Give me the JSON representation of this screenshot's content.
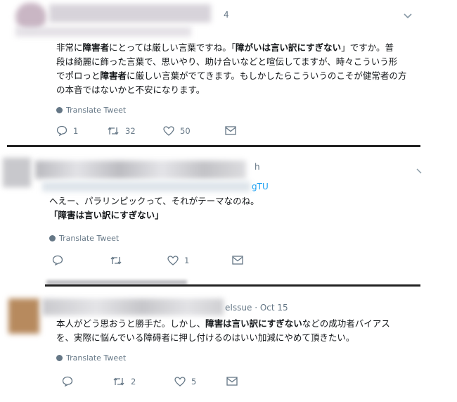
{
  "tweets": [
    {
      "header_suffix": "4",
      "text_lines": [
        [
          {
            "t": "非常に",
            "b": false
          },
          {
            "t": "障害者",
            "b": true
          },
          {
            "t": "にとっては厳しい言葉ですね。「",
            "b": false
          },
          {
            "t": "障がいは言い訳にすぎない",
            "b": true
          },
          {
            "t": "」ですか。普",
            "b": false
          }
        ],
        [
          {
            "t": "段は綺麗に飾った言葉で、思いやり、助け合いなどと喧伝してますが、時々こういう形",
            "b": false
          }
        ],
        [
          {
            "t": "でポロっと",
            "b": false
          },
          {
            "t": "障害者",
            "b": true
          },
          {
            "t": "に厳しい言葉がでてきます。もしかしたらこういうのこそが健常者の方",
            "b": false
          }
        ],
        [
          {
            "t": "の本音ではないかと不安になります。",
            "b": false
          }
        ]
      ],
      "translate_label": "Translate Tweet",
      "reply_count": "1",
      "retweet_count": "32",
      "like_count": "50"
    },
    {
      "header_suffix": "h",
      "handle_fragment": "gTU",
      "text_lines": [
        [
          {
            "t": "へえー、パラリンピックって、それがテーマなのね。",
            "b": false
          }
        ],
        [
          {
            "t": "「障害は言い訳にすぎない」",
            "b": true
          }
        ]
      ],
      "translate_label": "Translate Tweet",
      "reply_count": "",
      "retweet_count": "",
      "like_count": "1"
    },
    {
      "header_suffix": "eIssue · Oct 15",
      "text_lines": [
        [
          {
            "t": "本人がどう思おうと勝手だ。しかし、",
            "b": false
          },
          {
            "t": "障害は言い訳にすぎない",
            "b": true
          },
          {
            "t": "などの成功者バイアス",
            "b": false
          }
        ],
        [
          {
            "t": "を、実際に悩んでいる障碍者に押し付けるのはいい加減にやめて頂きたい。",
            "b": false
          }
        ]
      ],
      "translate_label": "Translate Tweet",
      "reply_count": "",
      "retweet_count": "2",
      "like_count": "5"
    }
  ]
}
